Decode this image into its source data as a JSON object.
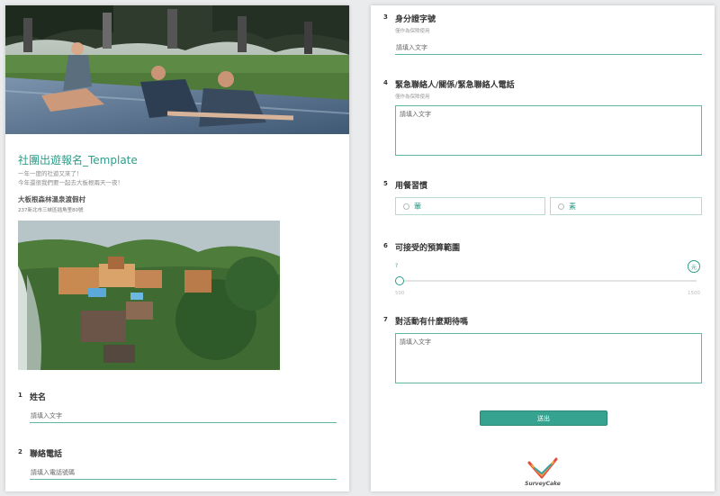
{
  "intro_section": {
    "title": "社團出遊報名_Template",
    "intro_line1": "一年一度的社遊又來了！",
    "intro_line2": "今年還很我們要一起去大板根兩天一夜！",
    "venue": "大板根森林溫泉渡假村",
    "address": "237新北市三峽區插角里80號"
  },
  "questions": [
    {
      "number": "1",
      "title": "姓名",
      "placeholder": "請填入文字"
    },
    {
      "number": "2",
      "title": "聯絡電話",
      "placeholder": "請填入電話號碼"
    },
    {
      "number": "3",
      "title": "身分證字號",
      "subtitle": "僅作為保險使用",
      "placeholder": "請填入文字"
    },
    {
      "number": "4",
      "title": "緊急聯絡人/關係/緊急聯絡人電話",
      "subtitle": "僅作為保險使用",
      "placeholder": "請填入文字"
    },
    {
      "number": "5",
      "title": "用餐習慣",
      "options": [
        "葷",
        "素"
      ]
    },
    {
      "number": "6",
      "title": "可接受的預算範圍",
      "value_display": "?",
      "unit": "元",
      "min": "500",
      "max": "1500",
      "current_fraction": 0
    },
    {
      "number": "7",
      "title": "對活動有什麼期待嗎",
      "placeholder": "請填入文字"
    }
  ],
  "submit_label": "送出",
  "brand": {
    "name": "SurveyCake"
  },
  "colors": {
    "accent": "#2f9c89",
    "button": "#35a38f",
    "border": "#5fb7a4"
  }
}
